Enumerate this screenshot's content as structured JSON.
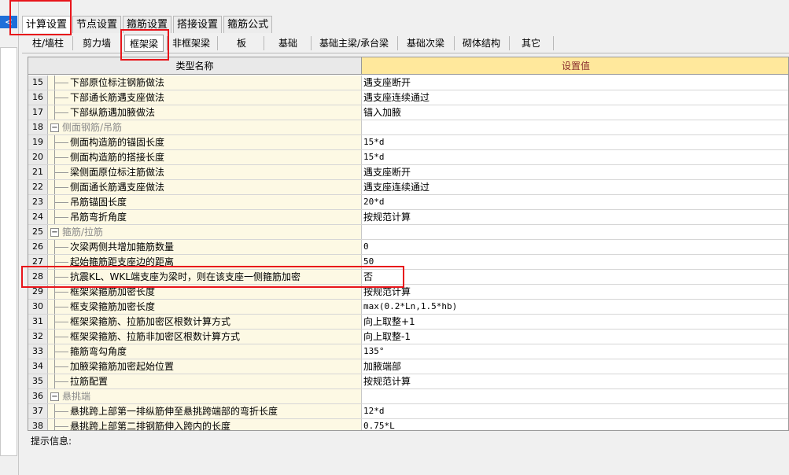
{
  "left_panel": {
    "collapse_glyph": "<"
  },
  "top_tabs": [
    "计算设置",
    "节点设置",
    "箍筋设置",
    "搭接设置",
    "箍筋公式"
  ],
  "sub_tabs": [
    "柱/墙柱",
    "剪力墙",
    "框架梁",
    "非框架梁",
    "板",
    "基础",
    "基础主梁/承台梁",
    "基础次梁",
    "砌体结构",
    "其它"
  ],
  "grid": {
    "col_name": "类型名称",
    "col_value": "设置值",
    "rows": [
      {
        "num": "15",
        "name": "下部原位标注钢筋做法",
        "value": "遇支座断开"
      },
      {
        "num": "16",
        "name": "下部通长筋遇支座做法",
        "value": "遇支座连续通过"
      },
      {
        "num": "17",
        "name": "下部纵筋遇加腋做法",
        "value": "锚入加腋"
      },
      {
        "num": "18",
        "name": "侧面钢筋/吊筋",
        "value": "",
        "group": true,
        "toggle": "−"
      },
      {
        "num": "19",
        "name": "侧面构造筋的锚固长度",
        "value": "15*d"
      },
      {
        "num": "20",
        "name": "侧面构造筋的搭接长度",
        "value": "15*d"
      },
      {
        "num": "21",
        "name": "梁侧面原位标注筋做法",
        "value": "遇支座断开"
      },
      {
        "num": "22",
        "name": "侧面通长筋遇支座做法",
        "value": "遇支座连续通过"
      },
      {
        "num": "23",
        "name": "吊筋锚固长度",
        "value": "20*d"
      },
      {
        "num": "24",
        "name": "吊筋弯折角度",
        "value": "按规范计算"
      },
      {
        "num": "25",
        "name": "箍筋/拉筋",
        "value": "",
        "group": true,
        "toggle": "−"
      },
      {
        "num": "26",
        "name": "次梁两侧共增加箍筋数量",
        "value": "0"
      },
      {
        "num": "27",
        "name": "起始箍筋距支座边的距离",
        "value": "50"
      },
      {
        "num": "28",
        "name": "抗震KL、WKL端支座为梁时，则在该支座一侧箍筋加密",
        "value": "否"
      },
      {
        "num": "29",
        "name": "框架梁箍筋加密长度",
        "value": "按规范计算"
      },
      {
        "num": "30",
        "name": "框支梁箍筋加密长度",
        "value": "max(0.2*Ln,1.5*hb)"
      },
      {
        "num": "31",
        "name": "框架梁箍筋、拉筋加密区根数计算方式",
        "value": "向上取整+1"
      },
      {
        "num": "32",
        "name": "框架梁箍筋、拉筋非加密区根数计算方式",
        "value": "向上取整-1"
      },
      {
        "num": "33",
        "name": "箍筋弯勾角度",
        "value": "135°"
      },
      {
        "num": "34",
        "name": "加腋梁箍筋加密起始位置",
        "value": "加腋端部"
      },
      {
        "num": "35",
        "name": "拉筋配置",
        "value": "按规范计算"
      },
      {
        "num": "36",
        "name": "悬挑端",
        "value": "",
        "group": true,
        "toggle": "−"
      },
      {
        "num": "37",
        "name": "悬挑跨上部第一排纵筋伸至悬挑跨端部的弯折长度",
        "value": "12*d"
      },
      {
        "num": "38",
        "name": "悬挑跨上部第二排钢筋伸入跨内的长度",
        "value": "0.75*L"
      }
    ]
  },
  "info_label": "提示信息:",
  "colors": {
    "annotation": "#e8151b",
    "value_header": "#ffe89c",
    "name_cell": "#fdf9e4"
  }
}
